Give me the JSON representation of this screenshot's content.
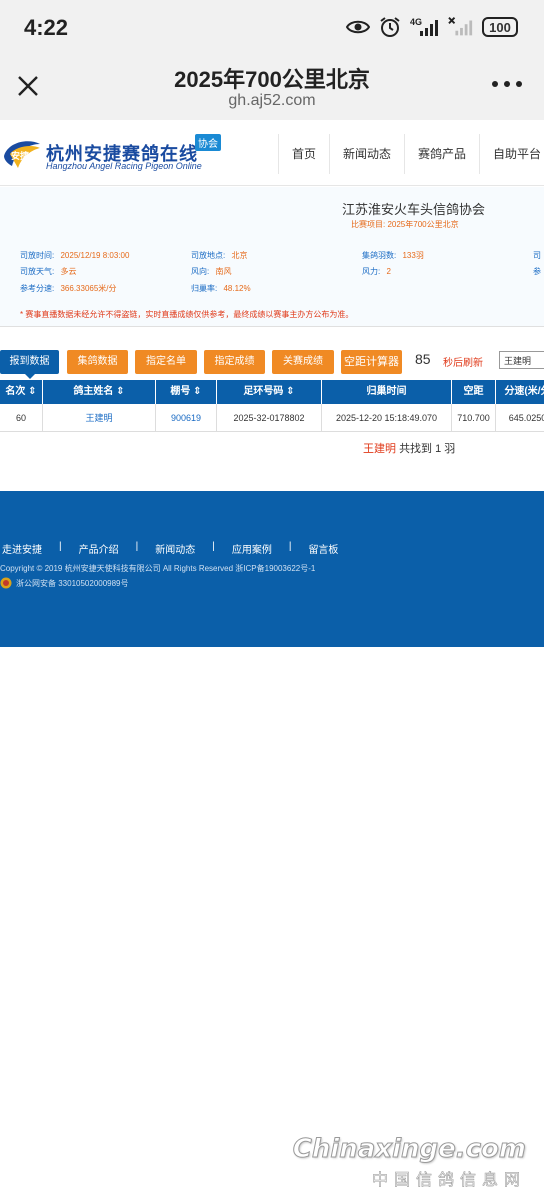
{
  "status_bar": {
    "time": "4:22",
    "network": "4G",
    "battery": "100",
    "icons": [
      "eye-icon",
      "alarm-icon",
      "signal-4g-icon",
      "signal-x-icon",
      "battery-icon"
    ]
  },
  "browser": {
    "title": "2025年700公里北京",
    "url": "gh.aj52.com",
    "close_icon": "close-icon",
    "more_icon": "more-icon"
  },
  "site": {
    "logo_cn": "杭州安捷赛鸽在线",
    "logo_en": "Hangzhou Angel Racing Pigeon Online",
    "logo_badge": "协会",
    "logo_mark_text": "安捷",
    "nav": [
      "首页",
      "新闻动态",
      "赛鸽产品",
      "自助平台"
    ]
  },
  "race": {
    "org_name": "江苏淮安火车头信鸽协会",
    "race_item": "比赛项目:  2025年700公里北京",
    "release_time_label": "司放时间:",
    "release_time": "2025/12/19 8:03:00",
    "release_place_label": "司放地点:",
    "release_place": "北京",
    "collected_label": "集鸽羽数:",
    "collected": "133羽",
    "weather_label": "司放天气:",
    "weather": "多云",
    "wind_dir_label": "风向:",
    "wind_dir": "南风",
    "wind_power_label": "风力:",
    "wind_power": "2",
    "ref_speed_label": "参考分速:",
    "ref_speed": "366.33065米/分",
    "return_rate_label": "归巢率:",
    "return_rate": "48.12%",
    "cut_col1": "司",
    "cut_col2": "参",
    "notice": "* 赛事直播数据未经允许不得盗链，实时直播成绩仅供参考，最终成绩以赛事主办方公布为准。"
  },
  "toolbar": {
    "buttons": [
      "报到数据",
      "集鸽数据",
      "指定名单",
      "指定成绩",
      "关赛成绩",
      "空距计算器"
    ],
    "countdown": "85",
    "refresh_label": "秒后刷新",
    "search_value": "王建明"
  },
  "table": {
    "headers": [
      "名次 ⇕",
      "鸽主姓名 ⇕",
      "棚号 ⇕",
      "足环号码 ⇕",
      "归巢时间",
      "空距",
      "分速(米/分"
    ],
    "rows": [
      [
        "60",
        "王建明",
        "900619",
        "2025-32-0178802",
        "2025-12-20 15:18:49.070",
        "710.700",
        "645.0250"
      ]
    ],
    "found_name": "王建明",
    "found_text": "共找到 1 羽"
  },
  "footer": {
    "links": [
      "走进安捷",
      "产品介绍",
      "新闻动态",
      "应用案例",
      "留言板"
    ],
    "separator": "|",
    "copyright": "Copyright © 2019 杭州安捷天使科技有限公司 All Rights Reserved 浙ICP备19003622号-1",
    "police": "浙公网安备 33010502000989号"
  },
  "watermark": {
    "en": "Chinaxinge.com",
    "cn": "中国信鸽信息网"
  },
  "colors": {
    "primary_blue": "#0b5fa9",
    "orange": "#f08a24",
    "red": "#e03a1a"
  }
}
